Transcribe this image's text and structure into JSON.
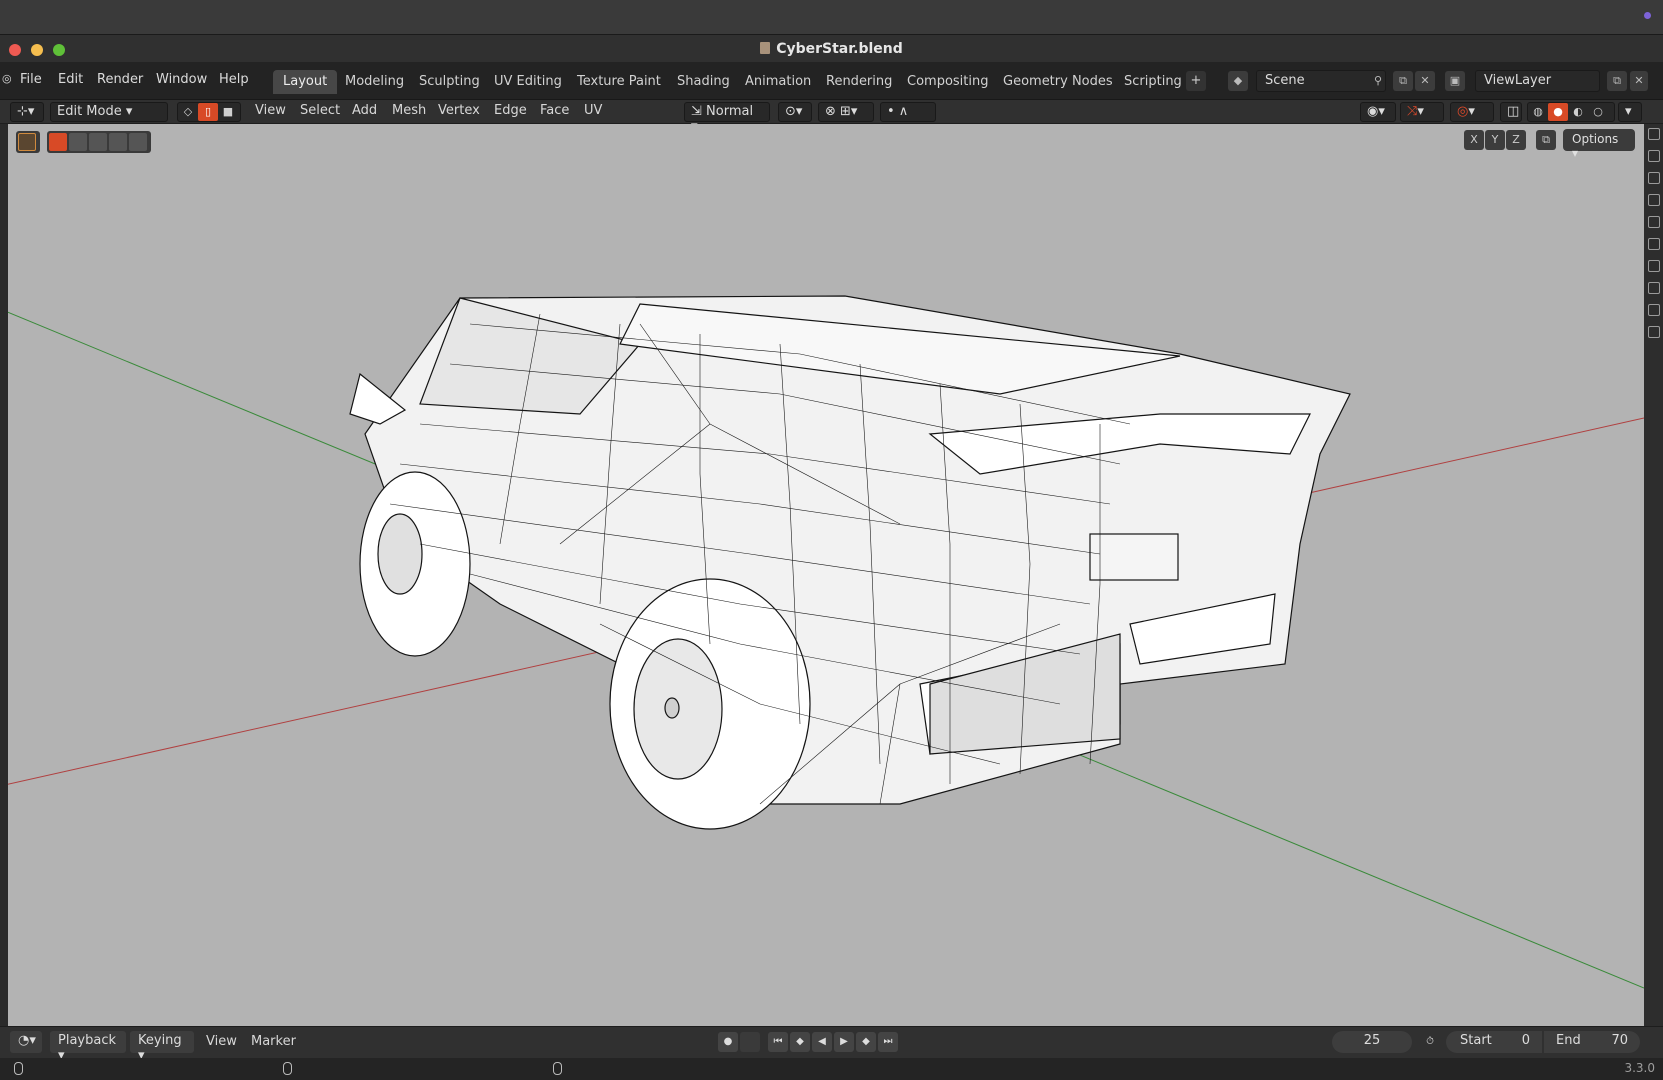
{
  "window": {
    "title": "CyberStar.blend"
  },
  "menu": {
    "items": [
      "File",
      "Edit",
      "Render",
      "Window",
      "Help"
    ]
  },
  "workspaces": [
    "Layout",
    "Modeling",
    "Sculpting",
    "UV Editing",
    "Texture Paint",
    "Shading",
    "Animation",
    "Rendering",
    "Compositing",
    "Geometry Nodes",
    "Scripting"
  ],
  "active_workspace": "Layout",
  "scene": {
    "name": "Scene"
  },
  "view_layer": {
    "name": "ViewLayer"
  },
  "header": {
    "mode": "Edit Mode",
    "menus": [
      "View",
      "Select",
      "Add",
      "Mesh",
      "Vertex",
      "Edge",
      "Face",
      "UV"
    ],
    "orientation": "Normal"
  },
  "viewport": {
    "axes_labels": [
      "X",
      "Y",
      "Z"
    ],
    "options_label": "Options",
    "background": "#b3b3b3",
    "x_axis_color": "#b04040",
    "y_axis_color": "#3a8a3a"
  },
  "timeline": {
    "playback_label": "Playback",
    "keying_label": "Keying",
    "view_label": "View",
    "marker_label": "Marker",
    "current_frame": "25",
    "start_label": "Start",
    "start_value": "0",
    "end_label": "End",
    "end_value": "70"
  },
  "status": {
    "version": "3.3.0"
  },
  "colors": {
    "accent": "#d84a26",
    "close": "#ee5a52",
    "minimize": "#f5be4f",
    "maximize": "#5fc038"
  }
}
